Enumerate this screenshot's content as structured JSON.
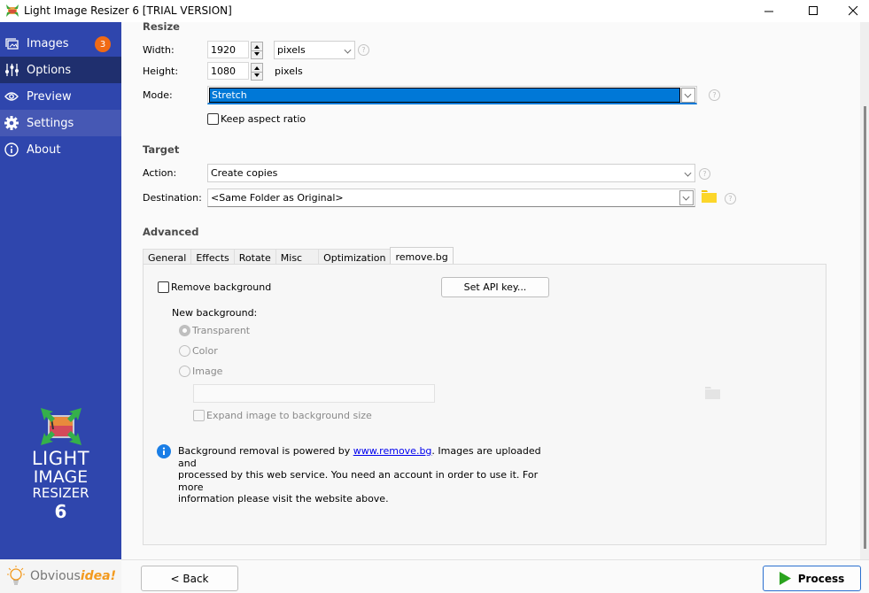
{
  "window": {
    "title": "Light Image Resizer 6  [TRIAL VERSION]",
    "controls": {
      "minimize": "minimize",
      "maximize": "maximize",
      "close": "close"
    }
  },
  "sidebar": {
    "items": [
      {
        "label": "Images",
        "icon": "images-icon",
        "badge": "3",
        "state": "normal"
      },
      {
        "label": "Options",
        "icon": "sliders-icon",
        "state": "selected"
      },
      {
        "label": "Preview",
        "icon": "eye-icon",
        "state": "normal"
      },
      {
        "label": "Settings",
        "icon": "gear-icon",
        "state": "hover"
      },
      {
        "label": "About",
        "icon": "info-icon",
        "state": "normal"
      }
    ],
    "logo": {
      "line1": "LIGHT",
      "line2": "IMAGE",
      "line3": "RESIZER",
      "line4": "6"
    },
    "vendor": {
      "prefix": "Obvious",
      "suffix": "idea!"
    }
  },
  "resize": {
    "title": "Resize",
    "width_label": "Width:",
    "width_value": "1920",
    "width_unit": "pixels",
    "height_label": "Height:",
    "height_value": "1080",
    "height_unit": "pixels",
    "mode_label": "Mode:",
    "mode_value": "Stretch",
    "keep_aspect_label": "Keep aspect ratio",
    "keep_aspect_checked": false
  },
  "target": {
    "title": "Target",
    "action_label": "Action:",
    "action_value": "Create copies",
    "destination_label": "Destination:",
    "destination_value": "<Same Folder as Original>"
  },
  "advanced": {
    "title": "Advanced",
    "tabs": [
      "General",
      "Effects",
      "Rotate",
      "Misc",
      "Optimization",
      "remove.bg"
    ],
    "active_tab": "remove.bg",
    "removebg": {
      "remove_background_label": "Remove background",
      "remove_background_checked": false,
      "set_api_key_label": "Set API key...",
      "new_background_label": "New background:",
      "options": [
        "Transparent",
        "Color",
        "Image"
      ],
      "selected_option": "Transparent",
      "image_path_value": "",
      "expand_label": "Expand image to background size",
      "info_pre": "Background removal is powered by ",
      "info_link": "www.remove.bg",
      "info_post": ". Images are uploaded and",
      "info_line2": "processed by this web service. You need an account in order to use it. For more",
      "info_line3": "information please visit the website above."
    }
  },
  "footer": {
    "back_label": "< Back",
    "process_label": "Process"
  },
  "colors": {
    "sidebar": "#2f46ad",
    "sidebar_selected": "#1f2f6e",
    "badge": "#f06a14",
    "selection": "#0078d7",
    "process_accent": "#0a9a0a"
  }
}
